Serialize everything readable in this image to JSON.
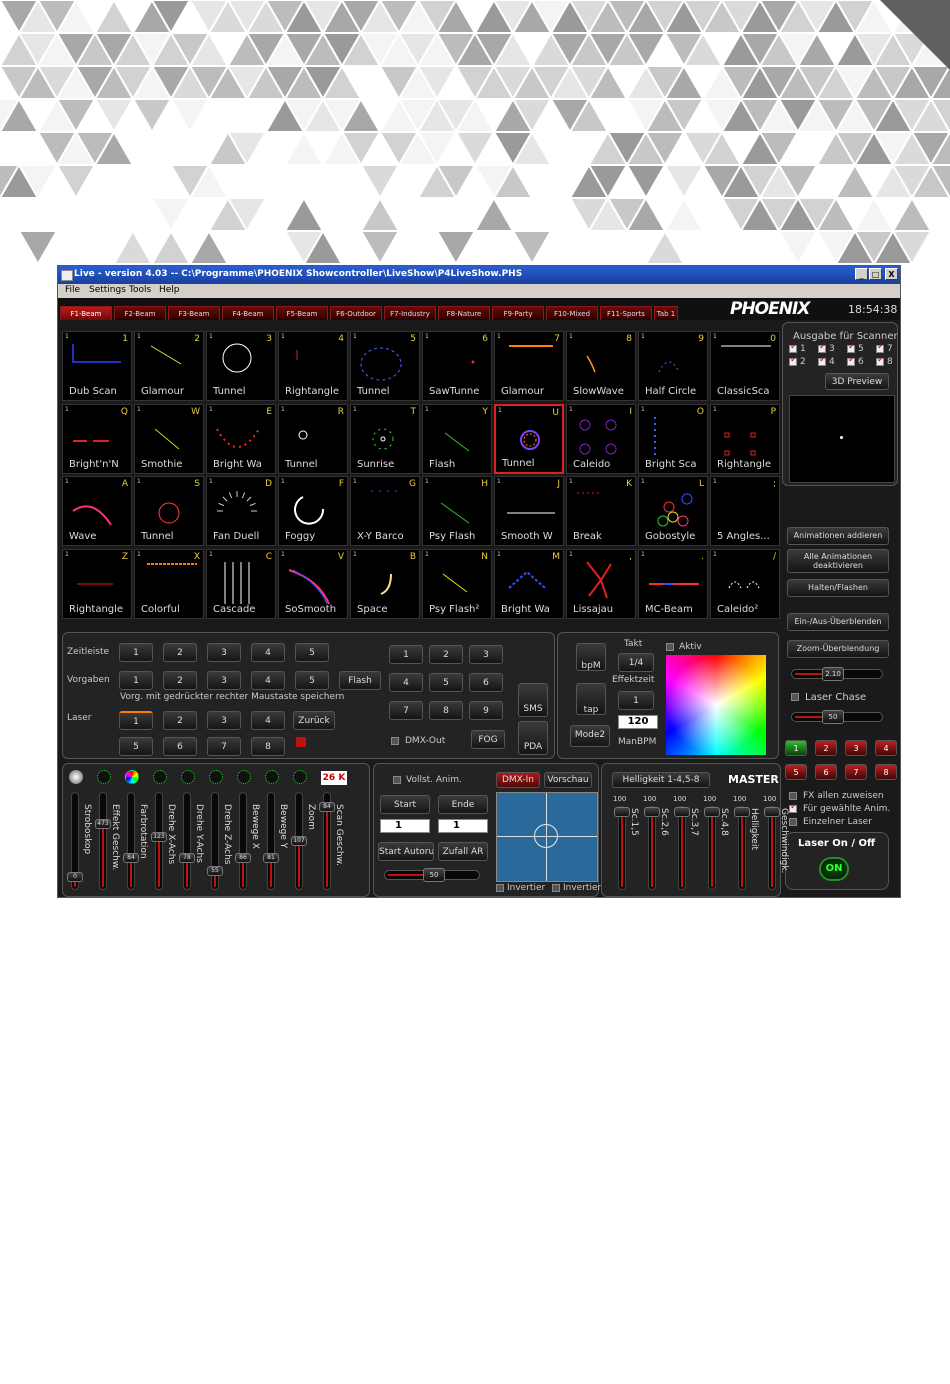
{
  "window": {
    "title": "Live - version 4.03 -- C:\\Programme\\PHOENIX Showcontroller\\LiveShow\\P4LiveShow.PHS",
    "buttons": [
      "_",
      "□",
      "X"
    ]
  },
  "menu": [
    "File",
    "Settings",
    "Tools",
    "Help"
  ],
  "tabs": [
    "F1-Beam",
    "F2-Beam",
    "F3-Beam",
    "F4-Beam",
    "F5-Beam",
    "F6-Outdoor",
    "F7-Industry",
    "F8-Nature",
    "F9-Party",
    "F10-Mixed",
    "F11-Sports",
    "Tab 1"
  ],
  "logo": "PHOENIX",
  "clock": "18:54:38",
  "animations": [
    {
      "key": "1",
      "label": "Dub Scan"
    },
    {
      "key": "2",
      "label": "Glamour"
    },
    {
      "key": "3",
      "label": "Tunnel"
    },
    {
      "key": "4",
      "label": "Rightangle"
    },
    {
      "key": "5",
      "label": "Tunnel"
    },
    {
      "key": "6",
      "label": "SawTunne"
    },
    {
      "key": "7",
      "label": "Glamour"
    },
    {
      "key": "8",
      "label": "SlowWave"
    },
    {
      "key": "9",
      "label": "Half Circle"
    },
    {
      "key": "0",
      "label": "ClassicSca"
    },
    {
      "key": "Q",
      "label": "Bright'n'N"
    },
    {
      "key": "W",
      "label": "Smothie"
    },
    {
      "key": "E",
      "label": "Bright Wa"
    },
    {
      "key": "R",
      "label": "Tunnel"
    },
    {
      "key": "T",
      "label": "Sunrise"
    },
    {
      "key": "Y",
      "label": "Flash"
    },
    {
      "key": "U",
      "label": "Tunnel"
    },
    {
      "key": "I",
      "label": "Caleido"
    },
    {
      "key": "O",
      "label": "Bright Sca"
    },
    {
      "key": "P",
      "label": "Rightangle"
    },
    {
      "key": "A",
      "label": "Wave"
    },
    {
      "key": "S",
      "label": "Tunnel"
    },
    {
      "key": "D",
      "label": "Fan Duell"
    },
    {
      "key": "F",
      "label": "Foggy"
    },
    {
      "key": "G",
      "label": "X-Y Barco"
    },
    {
      "key": "H",
      "label": "Psy Flash"
    },
    {
      "key": "J",
      "label": "Smooth W"
    },
    {
      "key": "K",
      "label": "Break"
    },
    {
      "key": "L",
      "label": "Gobostyle"
    },
    {
      "key": ";",
      "label": "5 Angles..."
    },
    {
      "key": "Z",
      "label": "Rightangle"
    },
    {
      "key": "X",
      "label": "Colorful"
    },
    {
      "key": "C",
      "label": "Cascade"
    },
    {
      "key": "V",
      "label": "SoSmooth"
    },
    {
      "key": "B",
      "label": "Space"
    },
    {
      "key": "N",
      "label": "Psy Flash²"
    },
    {
      "key": "M",
      "label": "Bright Wa"
    },
    {
      "key": ",",
      "label": "Lissajau"
    },
    {
      "key": ".",
      "label": "MC-Beam"
    },
    {
      "key": "/",
      "label": "Caleido²"
    }
  ],
  "scanner": {
    "title": "Ausgabe für Scanner",
    "items": [
      "1",
      "3",
      "5",
      "7",
      "2",
      "4",
      "6",
      "8"
    ],
    "preview_button": "3D Preview"
  },
  "side_buttons": [
    "Animationen addieren",
    "Alle Animationen deaktivieren",
    "Halten/Flashen",
    "Ein-/Aus-Überblenden",
    "Zoom-Überblendung"
  ],
  "zoom_value": "2.10",
  "laser_chase": {
    "label": "Laser Chase",
    "value": "50"
  },
  "laser_buttons": [
    "1",
    "2",
    "3",
    "4",
    "5",
    "6",
    "7",
    "8"
  ],
  "options": [
    "FX allen zuweisen",
    "Für gewählte Anim.",
    "Einzelner Laser"
  ],
  "laser_onoff": {
    "title": "Laser On / Off",
    "button": "ON"
  },
  "presets": {
    "zeitleiste_label": "Zeitleiste",
    "zeitleiste": [
      "1",
      "2",
      "3",
      "4",
      "5"
    ],
    "vorgaben_label": "Vorgaben",
    "vorgaben": [
      "1",
      "2",
      "3",
      "4",
      "5"
    ],
    "flash": "Flash",
    "hint": "Vorg. mit gedrückter rechter Maustaste speichern",
    "laser_label": "Laser",
    "laser_row1": [
      "1",
      "2",
      "3",
      "4"
    ],
    "zurueck": "Zurück",
    "laser_row2": [
      "5",
      "6",
      "7",
      "8"
    ],
    "numpad": [
      "1",
      "2",
      "3",
      "4",
      "5",
      "6",
      "7",
      "8",
      "9"
    ],
    "sms": "SMS",
    "dmx_out": "DMX-Out",
    "fog": "FOG",
    "pda": "PDA"
  },
  "timing": {
    "bpm": "bpM",
    "tap": "tap",
    "takt_label": "Takt",
    "takt": "1/4",
    "effektzeit_label": "Effektzeit",
    "effektzeit": "1",
    "manbpm_value": "120",
    "manbpm_label": "ManBPM",
    "mode": "Mode2",
    "aktiv": "Aktiv"
  },
  "effects": {
    "dmx_value": "26 K",
    "sliders": [
      {
        "label": "Stroboskop",
        "value": "0"
      },
      {
        "label": "Effekt Geschw.",
        "value": "473"
      },
      {
        "label": "Farbrotation",
        "value": "84"
      },
      {
        "label": "Drehe X-Achs",
        "value": "123"
      },
      {
        "label": "Drehe Y-Achs",
        "value": "78"
      },
      {
        "label": "Drehe Z-Achs",
        "value": "55"
      },
      {
        "label": "Bewege X",
        "value": "86"
      },
      {
        "label": "Bewege Y",
        "value": "81"
      },
      {
        "label": "Zoom",
        "value": "107"
      },
      {
        "label": "Scan Geschw.",
        "value": "84"
      }
    ]
  },
  "xy": {
    "vollst": "Vollst. Anim.",
    "dmx_in": "DMX-In",
    "vorschau": "Vorschau",
    "start": "Start",
    "ende": "Ende",
    "start_val": "1",
    "ende_val": "1",
    "start_autorun": "Start Autorun",
    "zufall": "Zufall AR",
    "slider_val": "50",
    "invert1": "Invertier",
    "invert2": "Invertier"
  },
  "master": {
    "helligkeit_label": "Helligkeit 1-4,5-8",
    "title": "MASTER",
    "sliders": [
      {
        "label": "Sc.1,5",
        "value": "100"
      },
      {
        "label": "Sc.2,6",
        "value": "100"
      },
      {
        "label": "Sc.3,7",
        "value": "100"
      },
      {
        "label": "Sc.4,8",
        "value": "100"
      },
      {
        "label": "Helligkeit",
        "value": "100"
      },
      {
        "label": "Geschwindigk.",
        "value": "100"
      }
    ]
  },
  "colors": {
    "accent": "#c01010",
    "bg": "#1a1a1a",
    "title_blue": "#2b5ecf"
  }
}
